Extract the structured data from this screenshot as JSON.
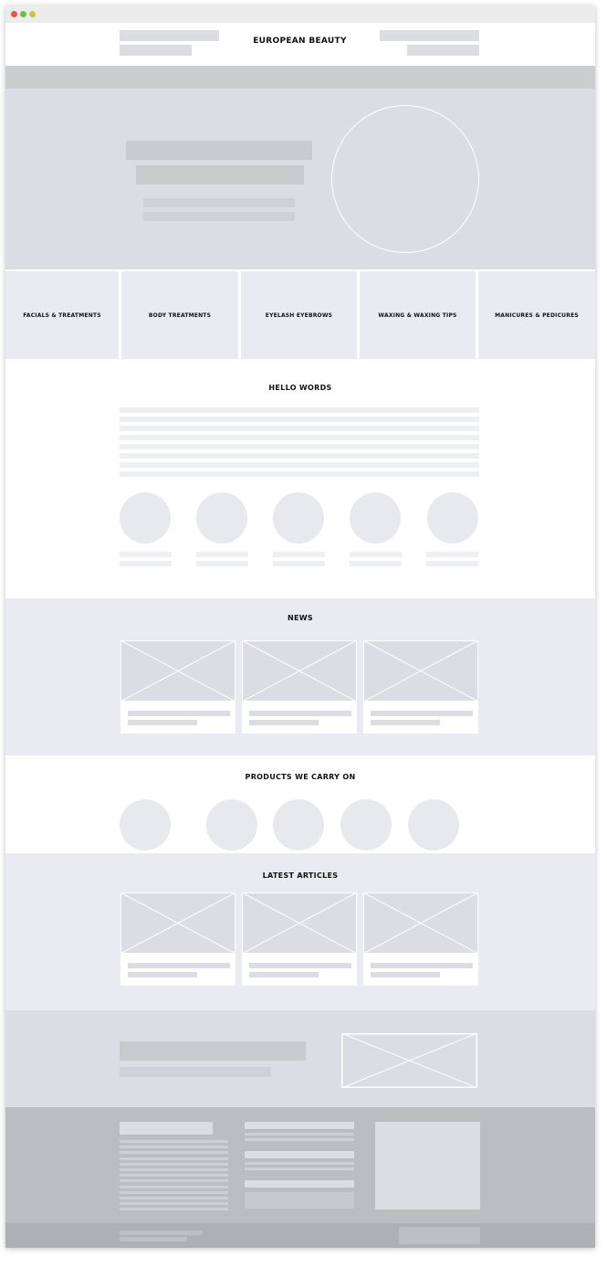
{
  "site": {
    "title": "EUROPEAN BEAUTY"
  },
  "window_controls": [
    {
      "name": "close",
      "color": "#e3574b"
    },
    {
      "name": "minimize",
      "color": "#f0b945"
    },
    {
      "name": "maximize",
      "color": "#69c14c"
    }
  ],
  "categories": [
    "FACIALS & TREATMENTS",
    "BODY TREATMENTS",
    "EYELASH EYEBROWS",
    "WAXING & WAXING TIPS",
    "MANICURES & PEDICURES"
  ],
  "sections": {
    "hello": "HELLO WORDS",
    "news": "NEWS",
    "products": "PRODUCTS WE CARRY ON",
    "articles": "LATEST ARTICLES"
  },
  "colors": {
    "hero_bg": "#dcdde4",
    "section_tint": "#eaebf2",
    "footer_bg": "#bcbdc0",
    "placeholder": "#c8cacd"
  }
}
